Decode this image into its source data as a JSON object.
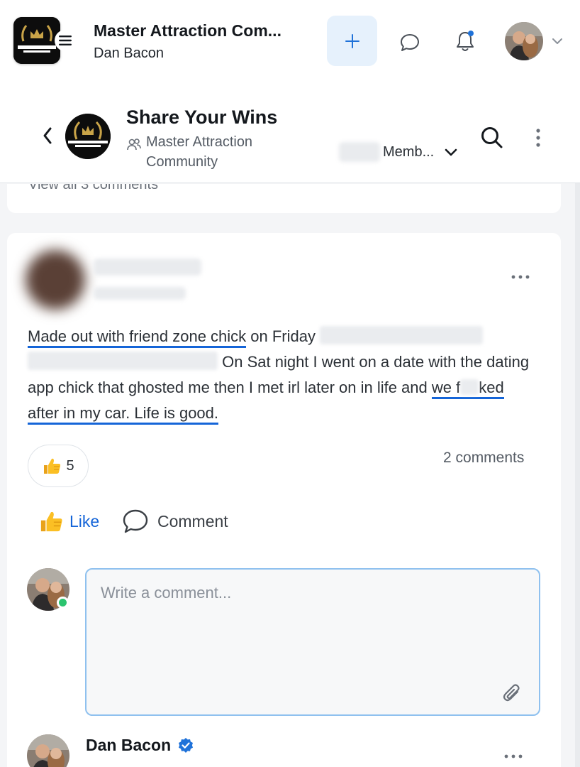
{
  "appbar": {
    "title": "Master Attraction Com...",
    "subtitle": "Dan Bacon",
    "logo_text": "MASTER ATTRACTION COMMUNITY"
  },
  "space": {
    "title": "Share Your Wins",
    "community": "Master Attraction Community",
    "members_label": "Memb..."
  },
  "previous_card": {
    "text": "View all 3 comments"
  },
  "post": {
    "body_1": "Made out with friend zone chick",
    "body_2": " on Friday ",
    "body_3": " On Sat night I went on a date with the dating app chick that ghosted me then I met irl later on in life and ",
    "body_4a": "we f",
    "body_4b": "ked after in my car. Life is good.",
    "reaction_count": "5",
    "comments_count": "2 comments",
    "like_label": "Like",
    "comment_label": "Comment"
  },
  "composer": {
    "placeholder": "Write a comment..."
  },
  "comment": {
    "author": "Dan Bacon"
  },
  "colors": {
    "accent": "#1565d8",
    "online": "#2bc46f",
    "plus_bg": "#e6f1fc"
  }
}
